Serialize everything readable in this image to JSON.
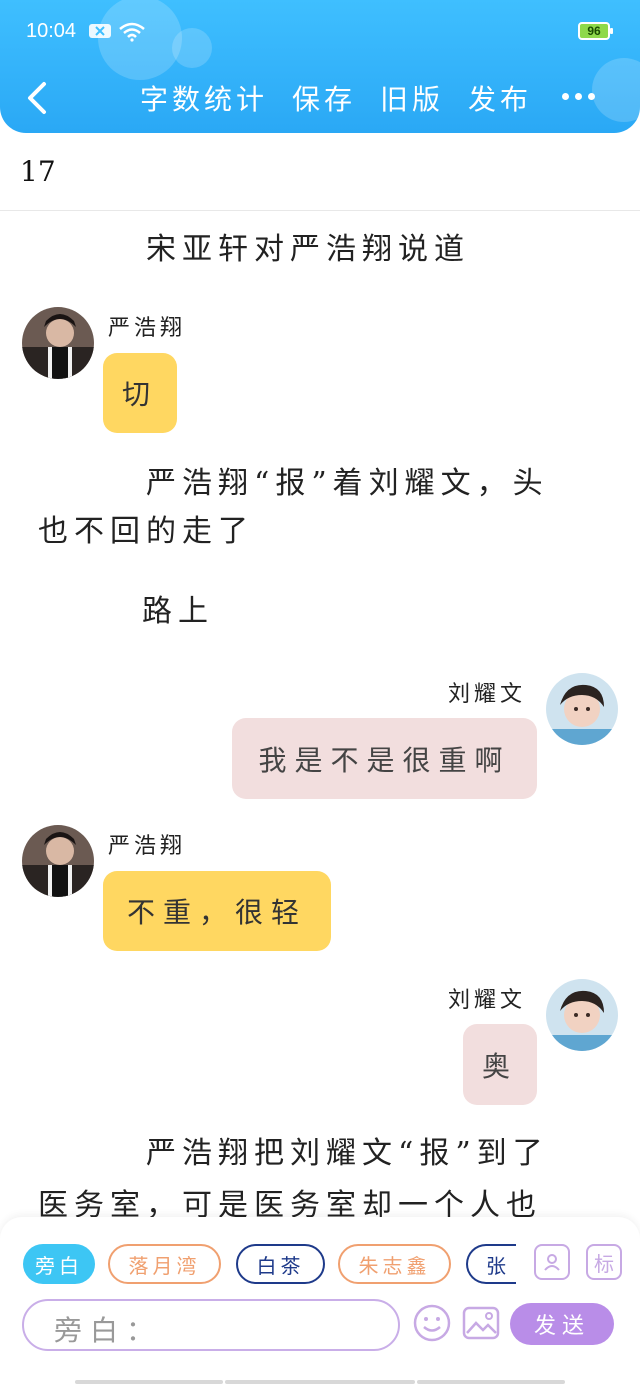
{
  "status": {
    "time": "10:04",
    "battery": "96"
  },
  "toolbar": {
    "word_count": "字数统计",
    "save": "保存",
    "old_version": "旧版",
    "publish": "发布"
  },
  "chapter": {
    "number": "17"
  },
  "story": {
    "narration_1": "宋亚轩对严浩翔说道",
    "msg_1": {
      "speaker": "严浩翔",
      "text": "切"
    },
    "narration_2_line1": "严浩翔“报”着刘耀文，头",
    "narration_2_line2": "也不回的走了",
    "narration_3": "路上",
    "msg_2": {
      "speaker": "刘耀文",
      "text": "我是不是很重啊"
    },
    "msg_3": {
      "speaker": "严浩翔",
      "text": "不重，很轻"
    },
    "msg_4": {
      "speaker": "刘耀文",
      "text": "奥"
    },
    "narration_4_line1": "严浩翔把刘耀文“报”到了",
    "narration_4_line2": "医务室，可是医务室却一个人也"
  },
  "roles": {
    "narrator": "旁白",
    "r1": "落月湾",
    "r2": "白茶",
    "r3": "朱志鑫",
    "r4": "张",
    "tag": "标"
  },
  "composer": {
    "placeholder": "旁白：",
    "send": "发送"
  },
  "colors": {
    "header": "#2aa8f5",
    "bubble_left": "#ffd761",
    "bubble_right": "#f2dede",
    "accent_purple": "#b98de8",
    "chip_orange": "#f0a070",
    "chip_navy": "#1e3a8a"
  }
}
